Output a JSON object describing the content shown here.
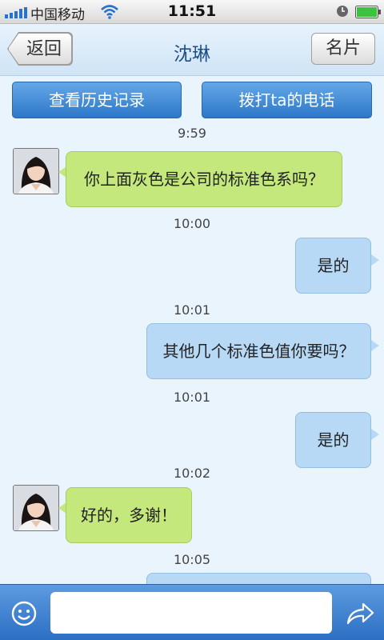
{
  "status_bar": {
    "carrier": "中国移动",
    "time": "11:51"
  },
  "nav": {
    "back_label": "返回",
    "title": "沈琳",
    "card_label": "名片"
  },
  "actions": {
    "history_label": "查看历史记录",
    "call_label": "拨打ta的电话"
  },
  "messages": [
    {
      "time": "9:59",
      "side": "left",
      "text": "你上面灰色是公司的标准色系吗？"
    },
    {
      "time": "10:00",
      "side": "right",
      "text": "是的"
    },
    {
      "time": "10:01",
      "side": "right",
      "text": "其他几个标准色值你要吗？"
    },
    {
      "time": "10:01",
      "side": "right",
      "text": "是的"
    },
    {
      "time": "10:02",
      "side": "left",
      "text": "好的，多谢！"
    },
    {
      "time": "10:05",
      "side": "right",
      "text": ""
    }
  ],
  "input": {
    "placeholder": ""
  },
  "icons": {
    "emoji": "smiley-icon",
    "send": "share-arrow-icon"
  },
  "colors": {
    "accent": "#2d77c8",
    "left_bubble": "#c4e87b",
    "right_bubble": "#b8d9f6",
    "title": "#1e4f88"
  }
}
